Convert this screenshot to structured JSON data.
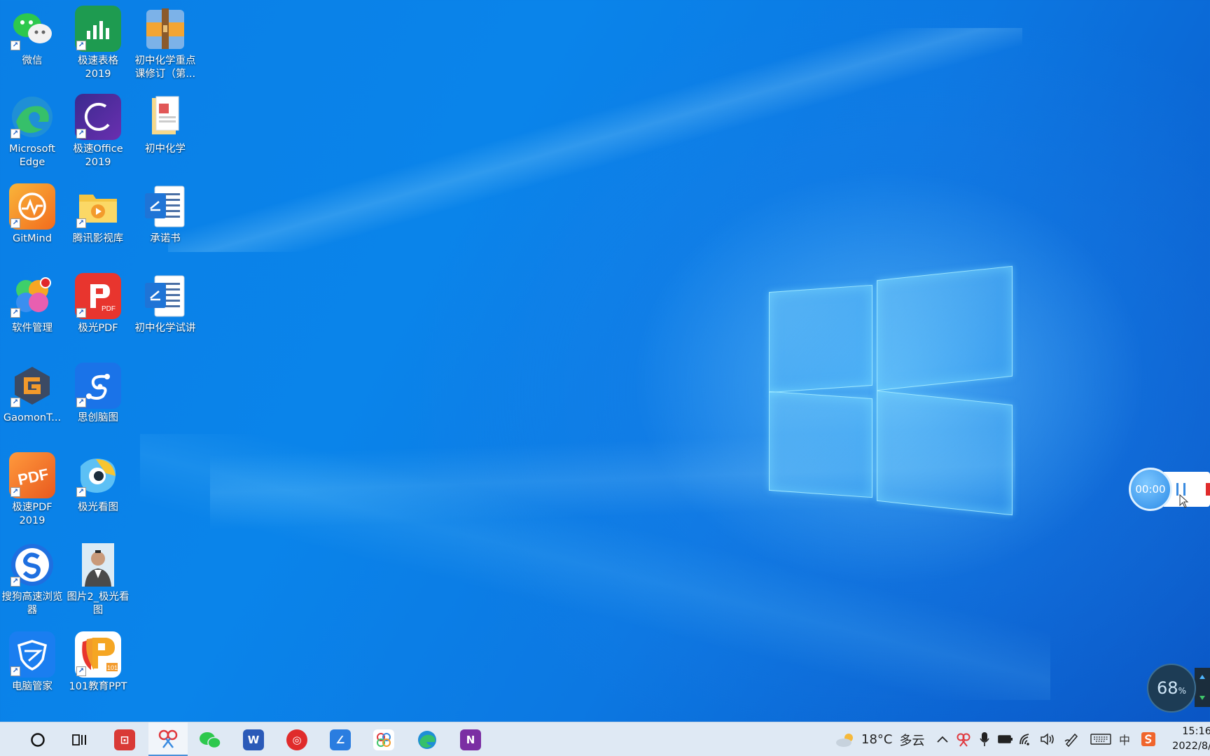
{
  "desktop": {
    "icons": [
      {
        "label": "微信",
        "icon": "wechat-icon"
      },
      {
        "label": "极速表格\n2019",
        "icon": "spreadsheet-icon"
      },
      {
        "label": "初中化学重点\n课修订（第...",
        "icon": "archive-icon"
      },
      {
        "label": "Microsoft\nEdge",
        "icon": "edge-icon"
      },
      {
        "label": "极速Office\n2019",
        "icon": "office-icon"
      },
      {
        "label": "初中化学",
        "icon": "folder-icon"
      },
      {
        "label": "GitMind",
        "icon": "gitmind-icon"
      },
      {
        "label": "腾讯影视库",
        "icon": "video-folder-icon"
      },
      {
        "label": "承诺书",
        "icon": "document-icon"
      },
      {
        "label": "软件管理",
        "icon": "software-manager-icon"
      },
      {
        "label": "极光PDF",
        "icon": "pdf-icon"
      },
      {
        "label": "初中化学试讲",
        "icon": "document-icon"
      },
      {
        "label": "GaomonT...",
        "icon": "gaomon-icon"
      },
      {
        "label": "思创脑图",
        "icon": "mindmap-icon"
      },
      {
        "label": "极速PDF\n2019",
        "icon": "pdf-icon"
      },
      {
        "label": "极光看图",
        "icon": "image-viewer-icon"
      },
      {
        "label": "搜狗高速浏览\n器",
        "icon": "sogou-browser-icon"
      },
      {
        "label": "图片2_极光看\n图",
        "icon": "photo-icon"
      },
      {
        "label": "电脑管家",
        "icon": "pc-manager-icon"
      },
      {
        "label": "101教育PPT",
        "icon": "ppt-icon"
      }
    ]
  },
  "recorder": {
    "time": "00:00"
  },
  "memory": {
    "percent": "68",
    "unit": "%"
  },
  "taskbar": {
    "apps": [
      {
        "name": "cortana"
      },
      {
        "name": "task-view"
      },
      {
        "name": "presentation"
      },
      {
        "name": "snipping"
      },
      {
        "name": "wechat"
      },
      {
        "name": "word"
      },
      {
        "name": "netease-music"
      },
      {
        "name": "pen-app"
      },
      {
        "name": "pinwheel"
      },
      {
        "name": "edge"
      },
      {
        "name": "onenote"
      }
    ],
    "weather": {
      "temp": "18°C",
      "condition": "多云"
    },
    "ime": "中",
    "clock": {
      "time": "15:16",
      "date": "2022/8/"
    }
  }
}
